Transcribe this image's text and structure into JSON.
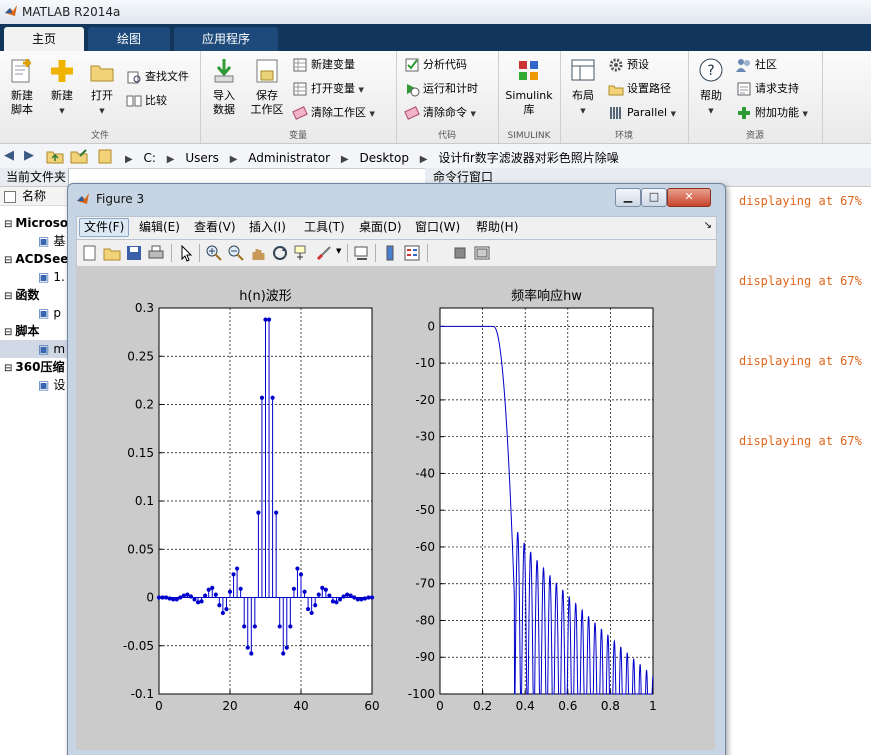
{
  "app": {
    "title": "MATLAB R2014a"
  },
  "tabs": [
    {
      "label": "主页",
      "active": true
    },
    {
      "label": "绘图",
      "active": false
    },
    {
      "label": "应用程序",
      "active": false
    }
  ],
  "ribbon": {
    "file": {
      "title": "文件",
      "new_script": "新建\n脚本",
      "new": "新建",
      "open": "打开",
      "find_files": "查找文件",
      "compare": "比较"
    },
    "variable": {
      "title": "变量",
      "import": "导入\n数据",
      "save_ws": "保存\n工作区",
      "new_var": "新建变量",
      "open_var": "打开变量",
      "clear_ws": "清除工作区"
    },
    "code": {
      "title": "代码",
      "analyze": "分析代码",
      "run_time": "运行和计时",
      "clear_cmd": "清除命令"
    },
    "simulink": {
      "title": "SIMULINK",
      "lib": "Simulink\n库"
    },
    "env": {
      "title": "环境",
      "layout": "布局",
      "prefs": "预设",
      "set_path": "设置路径",
      "parallel": "Parallel"
    },
    "resources": {
      "title": "资源",
      "help": "帮助",
      "community": "社区",
      "support": "请求支持",
      "addons": "附加功能"
    }
  },
  "address": {
    "crumbs": [
      "C:",
      "Users",
      "Administrator",
      "Desktop",
      "设计fir数字滤波器对彩色照片除噪"
    ]
  },
  "left_panel": {
    "header": "当前文件夹",
    "col_name": "名称",
    "rows": [
      {
        "text": "Microso",
        "group": true
      },
      {
        "text": "基",
        "group": false
      },
      {
        "text": "ACDSee",
        "group": true
      },
      {
        "text": "1.",
        "group": false
      },
      {
        "text": "函数",
        "group": true
      },
      {
        "text": "p",
        "group": false
      },
      {
        "text": "脚本",
        "group": true
      },
      {
        "text": "m",
        "group": false,
        "selected": true
      },
      {
        "text": "360压缩",
        "group": true
      },
      {
        "text": "设",
        "group": false
      }
    ]
  },
  "command_window": {
    "header": "命令行窗口",
    "lines": [
      "displaying at 67%",
      "displaying at 67%",
      "displaying at 67%",
      "displaying at 67%"
    ]
  },
  "figure": {
    "title": "Figure 3",
    "menus": [
      "文件(F)",
      "编辑(E)",
      "查看(V)",
      "插入(I)",
      "工具(T)",
      "桌面(D)",
      "窗口(W)",
      "帮助(H)"
    ],
    "toolbar_icons": [
      "new-figure-icon",
      "open-file-icon",
      "save-icon",
      "print-icon",
      "pointer-icon",
      "zoom-in-icon",
      "zoom-out-icon",
      "pan-hand-icon",
      "rotate-3d-icon",
      "data-cursor-icon",
      "brush-icon",
      "link-plot-icon",
      "colorbar-icon",
      "legend-icon",
      "hide-plot-tools-icon",
      "show-plot-tools-icon"
    ]
  },
  "chart_data": [
    {
      "type": "stem",
      "title": "h(n)波形",
      "xlim": [
        0,
        60
      ],
      "ylim": [
        -0.1,
        0.3
      ],
      "xticks": [
        "0",
        "20",
        "40",
        "60"
      ],
      "yticks": [
        "-0.1",
        "-0.05",
        "0",
        "0.05",
        "0.1",
        "0.15",
        "0.2",
        "0.25",
        "0.3"
      ],
      "grid": true,
      "color": "#0000cc",
      "x": [
        0,
        1,
        2,
        3,
        4,
        5,
        6,
        7,
        8,
        9,
        10,
        11,
        12,
        13,
        14,
        15,
        16,
        17,
        18,
        19,
        20,
        21,
        22,
        23,
        24,
        25,
        26,
        27,
        28,
        29,
        30,
        31,
        32,
        33,
        34,
        35,
        36,
        37,
        38,
        39,
        40,
        41,
        42,
        43,
        44,
        45,
        46,
        47,
        48,
        49,
        50,
        51,
        52,
        53,
        54,
        55,
        56,
        57,
        58,
        59,
        60
      ],
      "y": [
        0,
        0,
        0,
        -0.001,
        -0.002,
        -0.002,
        0,
        0.002,
        0.003,
        0.001,
        -0.002,
        -0.005,
        -0.004,
        0.002,
        0.008,
        0.01,
        0.003,
        -0.008,
        -0.016,
        -0.012,
        0.006,
        0.024,
        0.03,
        0.009,
        -0.03,
        -0.052,
        -0.058,
        -0.03,
        0.088,
        0.207,
        0.288,
        0.288,
        0.207,
        0.088,
        -0.03,
        -0.058,
        -0.052,
        -0.03,
        0.009,
        0.03,
        0.024,
        0.006,
        -0.012,
        -0.016,
        -0.008,
        0.003,
        0.01,
        0.008,
        0.002,
        -0.004,
        -0.005,
        -0.002,
        0.001,
        0.003,
        0.002,
        0,
        -0.002,
        -0.002,
        -0.001,
        0,
        0
      ]
    },
    {
      "type": "line",
      "title": "频率响应hw",
      "xlim": [
        0,
        1
      ],
      "ylim": [
        -100,
        5
      ],
      "xticks": [
        "0",
        "0.2",
        "0.4",
        "0.6",
        "0.8",
        "1"
      ],
      "yticks": [
        "0",
        "-10",
        "-20",
        "-30",
        "-40",
        "-50",
        "-60",
        "-70",
        "-80",
        "-90",
        "-100"
      ],
      "grid": true,
      "color": "#0000cc",
      "passband_edge": 0.25,
      "stopband_start": 0.35,
      "first_sidelobe_db": -52,
      "last_sidelobe_db": -93
    }
  ]
}
